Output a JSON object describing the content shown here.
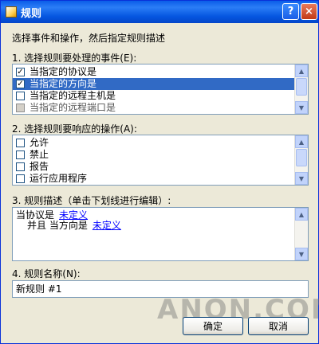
{
  "window": {
    "title": "规则"
  },
  "titlebar": {
    "help_glyph": "?",
    "close_glyph": "×"
  },
  "instructions": "选择事件和操作，然后指定规则描述",
  "step1": {
    "label": "1. 选择规则要处理的事件(E):",
    "items": [
      {
        "label": "当指定的协议是",
        "checked": true,
        "selected": false,
        "disabled": false
      },
      {
        "label": "当指定的方向是",
        "checked": true,
        "selected": true,
        "disabled": false
      },
      {
        "label": "当指定的远程主机是",
        "checked": false,
        "selected": false,
        "disabled": false
      },
      {
        "label": "当指定的远程端口是",
        "checked": false,
        "selected": false,
        "disabled": true
      }
    ]
  },
  "step2": {
    "label": "2. 选择规则要响应的操作(A):",
    "items": [
      {
        "label": "允许",
        "checked": false
      },
      {
        "label": "禁止",
        "checked": false
      },
      {
        "label": "报告",
        "checked": false
      },
      {
        "label": "运行应用程序",
        "checked": false
      }
    ]
  },
  "step3": {
    "label": "3. 规则描述（单击下划线进行编辑）:",
    "line1_text": "当协议是",
    "line1_link": "未定义",
    "line2_text": "并且 当方向是",
    "line2_link": "未定义"
  },
  "step4": {
    "label": "4. 规则名称(N):",
    "value": "新规则 #1"
  },
  "buttons": {
    "ok": "确定",
    "cancel": "取消"
  },
  "watermark": "ANQN.COM",
  "colors": {
    "titlebar": "#0a5de8",
    "selection": "#316ac5",
    "link": "#0000ff",
    "dialog_bg": "#ece9d8"
  }
}
